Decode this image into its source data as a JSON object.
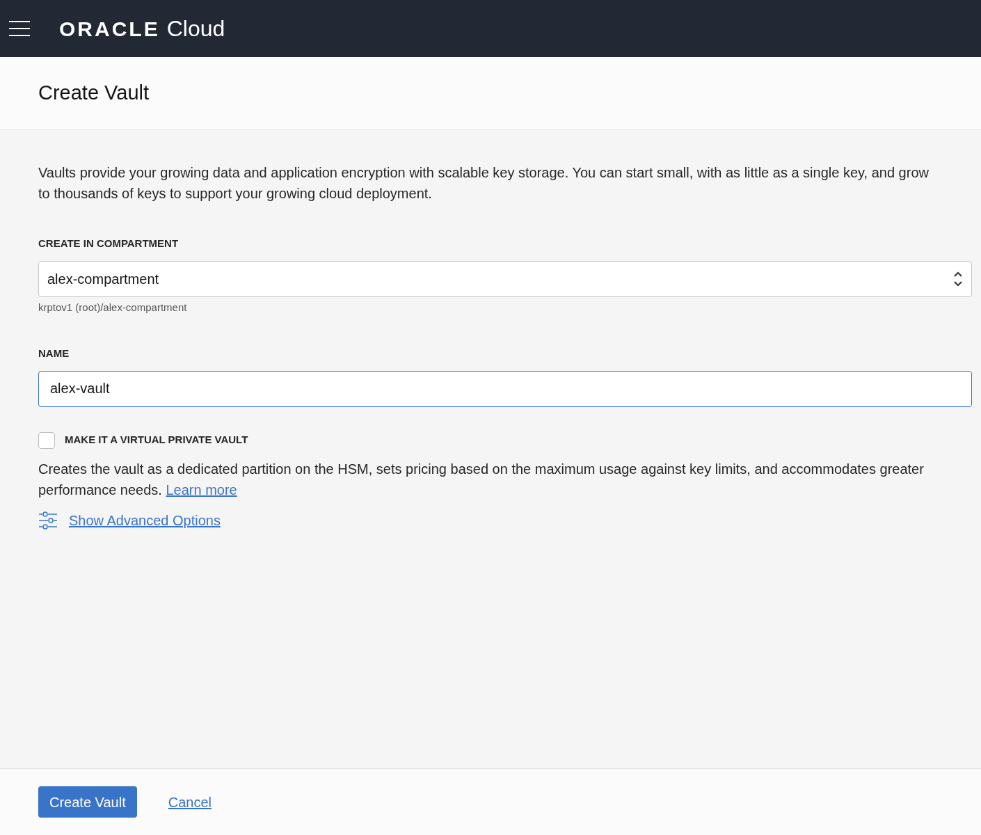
{
  "header": {
    "brand": "ORACLE",
    "product": "Cloud"
  },
  "page_title": "Create Vault",
  "intro": "Vaults provide your growing data and application encryption with scalable key storage. You can start small, with as little as a single key, and grow to thousands of keys to support your growing cloud deployment.",
  "compartment": {
    "label": "CREATE IN COMPARTMENT",
    "value": "alex-compartment",
    "path": "krptov1 (root)/alex-compartment"
  },
  "name": {
    "label": "NAME",
    "value": "alex-vault",
    "focused": true
  },
  "virtual_private": {
    "label": "MAKE IT A VIRTUAL PRIVATE VAULT",
    "checked": false,
    "description": "Creates the vault as a dedicated partition on the HSM, sets pricing based on the maximum usage against key limits, and accommodates greater performance needs.",
    "link": "Learn more"
  },
  "advanced_link": "Show Advanced Options",
  "buttons": [
    {
      "kind": "primary",
      "label": "Create Vault"
    },
    {
      "kind": "link",
      "label": "Cancel"
    }
  ]
}
